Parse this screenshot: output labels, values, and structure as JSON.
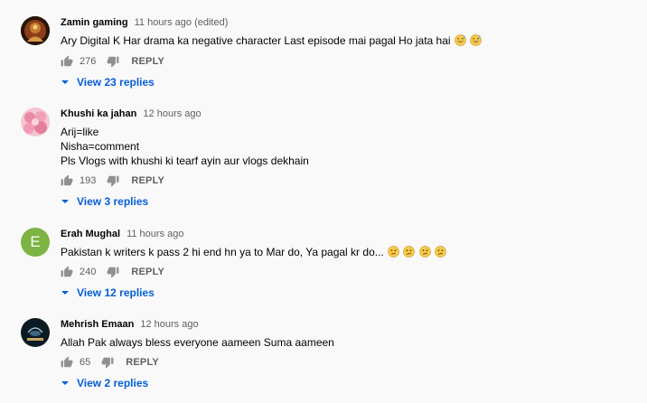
{
  "comments": [
    {
      "author": "Zamin gaming",
      "time": "11 hours ago (edited)",
      "text_lines": [
        "Ary Digital K Har drama ka negative character Last episode mai pagal Ho jata hai"
      ],
      "emoji_name": "grinning-sweat-emoji",
      "likes": "276",
      "reply_label": "REPLY",
      "view_replies": "View 23 replies"
    },
    {
      "author": "Khushi ka jahan",
      "time": "12 hours ago",
      "text_lines": [
        "Arij=like",
        "Nisha=comment",
        "Pls Vlogs with khushi ki tearf ayin aur vlogs dekhain"
      ],
      "likes": "193",
      "reply_label": "REPLY",
      "view_replies": "View 3 replies"
    },
    {
      "author": "Erah Mughal",
      "time": "11 hours ago",
      "avatar_letter": "E",
      "text_lines": [
        "Pakistan k writers k pass 2 hi end hn ya to Mar do, Ya pagal kr do..."
      ],
      "emoji_name": "confused-face-emoji",
      "likes": "240",
      "reply_label": "REPLY",
      "view_replies": "View 12 replies"
    },
    {
      "author": "Mehrish Emaan",
      "time": "12 hours ago",
      "text_lines": [
        "Allah Pak always bless everyone aameen Suma aameen"
      ],
      "likes": "65",
      "reply_label": "REPLY",
      "view_replies": "View 2 replies"
    }
  ],
  "colors": {
    "link": "#065fd4",
    "meta": "#606060",
    "avatar_e": "#7cb342"
  }
}
